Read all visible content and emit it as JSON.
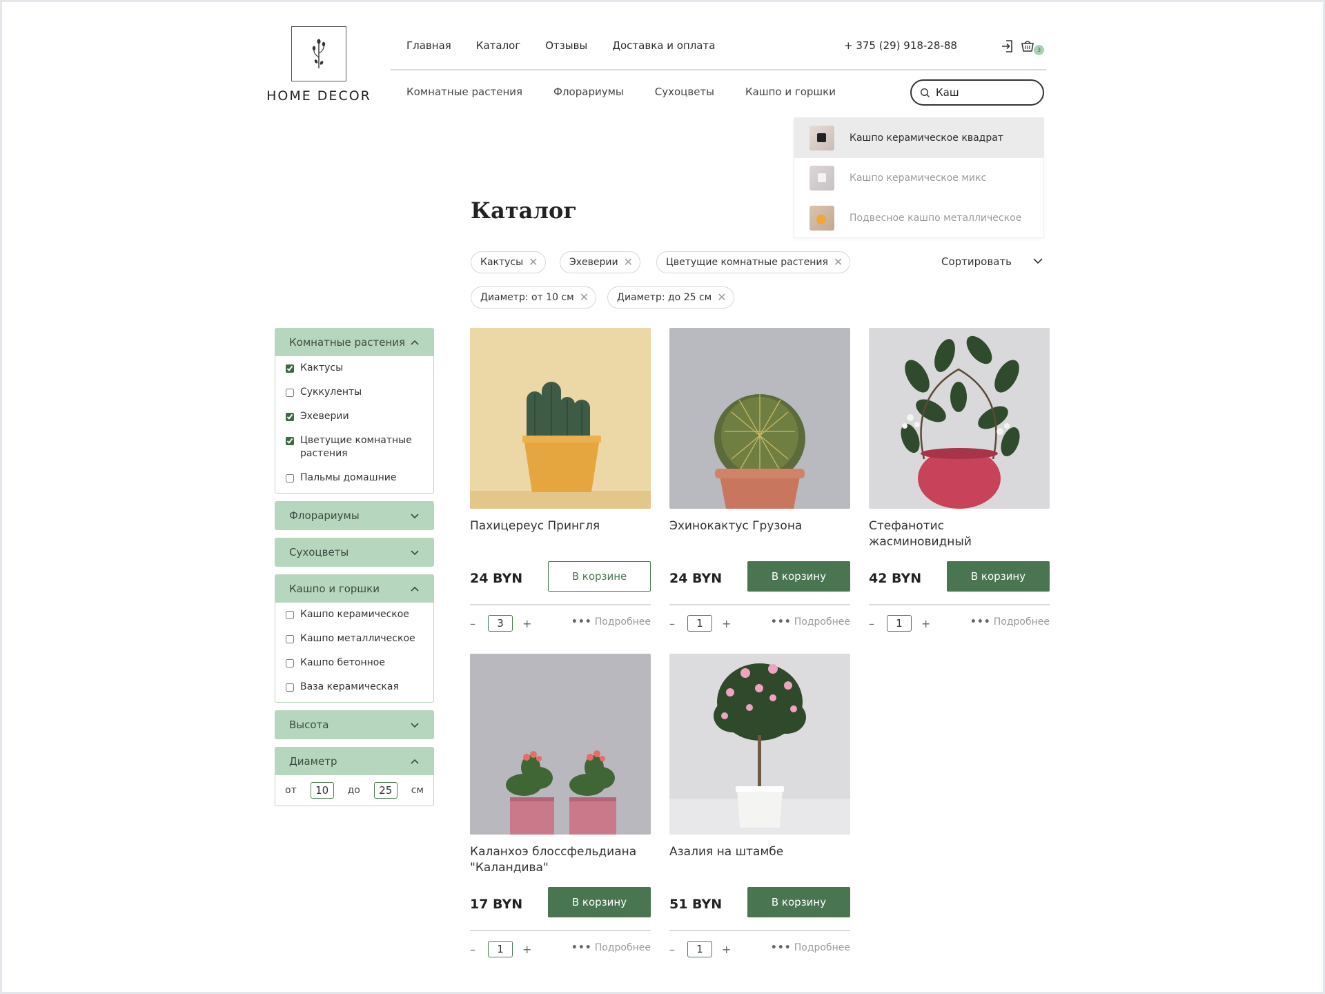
{
  "header": {
    "logo_text": "HOME DECOR",
    "nav": [
      "Главная",
      "Каталог",
      "Отзывы",
      "Доставка и оплата"
    ],
    "phone": "+ 375 (29) 918-28-88",
    "cart_count": "3",
    "categories": [
      "Комнатные растения",
      "Флорариумы",
      "Сухоцветы",
      "Кашпо и горшки"
    ]
  },
  "search": {
    "value": "Каш",
    "suggestions": [
      "Кашпо керамическое квадрат",
      "Кашпо керамическое микс",
      "Подвесное кашпо металлическое"
    ]
  },
  "page": {
    "title": "Каталог",
    "sort_label": "Сортировать"
  },
  "filters_active": [
    "Кактусы",
    "Эхеверии",
    "Цветущие комнатные растения",
    "Диаметр: от 10 см",
    "Диаметр: до 25 см"
  ],
  "sidebar": {
    "groups": [
      {
        "title": "Комнатные растения",
        "expanded": true,
        "options": [
          {
            "label": "Кактусы",
            "checked": true
          },
          {
            "label": "Суккуленты",
            "checked": false
          },
          {
            "label": "Эхеверии",
            "checked": true
          },
          {
            "label": "Цветущие комнатные растения",
            "checked": true
          },
          {
            "label": "Пальмы домашние",
            "checked": false
          }
        ]
      },
      {
        "title": "Флорариумы",
        "expanded": false
      },
      {
        "title": "Сухоцветы",
        "expanded": false
      },
      {
        "title": "Кашпо и горшки",
        "expanded": true,
        "options": [
          {
            "label": "Кашпо керамическое",
            "checked": false
          },
          {
            "label": "Кашпо металлическое",
            "checked": false
          },
          {
            "label": "Кашпо бетонное",
            "checked": false
          },
          {
            "label": "Ваза керамическая",
            "checked": false
          }
        ]
      },
      {
        "title": "Высота",
        "expanded": false
      },
      {
        "title": "Диаметр",
        "expanded": true,
        "from_label": "от",
        "from_value": "10",
        "to_label": "до",
        "to_value": "25",
        "unit": "см"
      }
    ]
  },
  "products": [
    {
      "name": "Пахицереус Прингля",
      "price": "24 BYN",
      "button": "В корзине",
      "in_cart": true,
      "qty": "3",
      "more": "Подробнее"
    },
    {
      "name": "Эхинокактус Грузона",
      "price": "24 BYN",
      "button": "В корзину",
      "in_cart": false,
      "qty": "1",
      "more": "Подробнее"
    },
    {
      "name": "Стефанотис жасминовидный",
      "price": "42 BYN",
      "button": "В корзину",
      "in_cart": false,
      "qty": "1",
      "more": "Подробнее"
    },
    {
      "name": "Каланхоэ блоссфельдиана \"Каландива\"",
      "price": "17 BYN",
      "button": "В корзину",
      "in_cart": false,
      "qty": "1",
      "more": "Подробнее"
    },
    {
      "name": "Азалия на штамбе",
      "price": "51 BYN",
      "button": "В корзину",
      "in_cart": false,
      "qty": "1",
      "more": "Подробнее"
    }
  ],
  "colors": {
    "accent": "#4a7551",
    "sidebar_header": "#b6d6bd",
    "badge": "#a9d1b3"
  }
}
